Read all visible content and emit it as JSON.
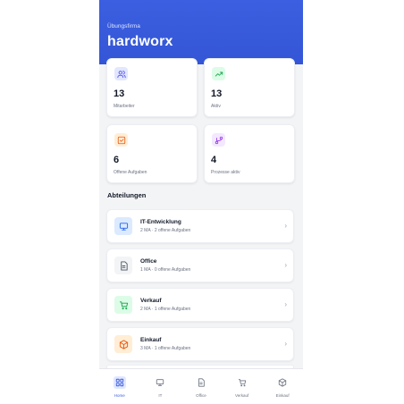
{
  "header": {
    "company_label": "Übungsfirma",
    "company_name": "hardworx"
  },
  "stats": [
    {
      "icon": "users-icon",
      "value": "13",
      "label": "Mitarbeiter",
      "color": "#4f46e5",
      "bg": "#e0e7ff"
    },
    {
      "icon": "trending-up-icon",
      "value": "13",
      "label": "Aktiv",
      "color": "#16a34a",
      "bg": "#dcfce7"
    },
    {
      "icon": "checkbox-icon",
      "value": "6",
      "label": "Offene Aufgaben",
      "color": "#ea580c",
      "bg": "#ffedd5"
    },
    {
      "icon": "git-branch-icon",
      "value": "4",
      "label": "Prozesse aktiv",
      "color": "#9333ea",
      "bg": "#f3e8ff"
    }
  ],
  "section_title": "Abteilungen",
  "departments": [
    {
      "icon": "monitor-icon",
      "name": "IT-Entwicklung",
      "meta": "2 MA · 2 offene Aufgaben",
      "color": "#2563eb",
      "bg": "#dbeafe"
    },
    {
      "icon": "document-icon",
      "name": "Office",
      "meta": "1 MA · 0 offene Aufgaben",
      "color": "#4b5563",
      "bg": "#f3f4f6"
    },
    {
      "icon": "cart-icon",
      "name": "Verkauf",
      "meta": "2 MA · 1 offene Aufgaben",
      "color": "#16a34a",
      "bg": "#dcfce7"
    },
    {
      "icon": "box-icon",
      "name": "Einkauf",
      "meta": "3 MA · 1 offene Aufgaben",
      "color": "#ea580c",
      "bg": "#ffedd5"
    }
  ],
  "chevron": "›",
  "bottom_nav": [
    {
      "icon": "grid-icon",
      "label": "Home",
      "active": true
    },
    {
      "icon": "monitor-icon",
      "label": "IT",
      "active": false
    },
    {
      "icon": "document-icon",
      "label": "Office",
      "active": false
    },
    {
      "icon": "cart-icon",
      "label": "Verkauf",
      "active": false
    },
    {
      "icon": "box-icon",
      "label": "Einkauf",
      "active": false
    }
  ],
  "accent_color": "#3b5bdb"
}
